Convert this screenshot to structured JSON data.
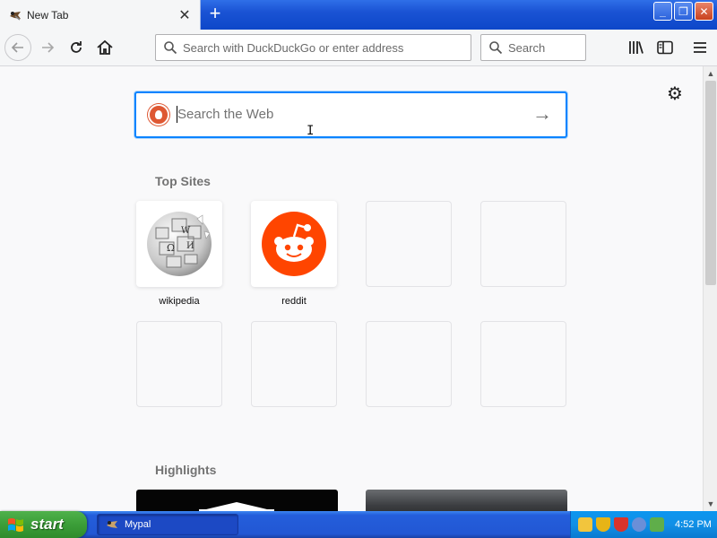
{
  "browser": {
    "tab": {
      "title": "New Tab",
      "close_glyph": "✕"
    },
    "new_tab_glyph": "+",
    "window_controls": {
      "minimize": "_",
      "maximize": "❐",
      "close": "✕"
    },
    "nav": {
      "back_icon": "arrow-left-icon",
      "forward_icon": "arrow-right-icon",
      "reload_icon": "reload-icon",
      "home_icon": "home-icon"
    },
    "urlbar": {
      "placeholder": "Search with DuckDuckGo or enter address"
    },
    "searchbar": {
      "placeholder": "Search"
    }
  },
  "newtab": {
    "web_search": {
      "placeholder": "Search the Web",
      "arrow": "→"
    },
    "top_sites": {
      "title": "Top Sites",
      "sites": [
        {
          "label": "wikipedia",
          "icon": "wikipedia-globe-icon"
        },
        {
          "label": "reddit",
          "icon": "reddit-alien-icon"
        }
      ]
    },
    "highlights": {
      "title": "Highlights"
    }
  },
  "taskbar": {
    "start_label": "start",
    "task_label": "Mypal",
    "clock": "4:52 PM"
  },
  "colors": {
    "accent": "#0a84ff",
    "ddg": "#de5833",
    "reddit": "#ff4500",
    "xp_blue": "#245edb",
    "xp_green": "#3b9e38"
  }
}
